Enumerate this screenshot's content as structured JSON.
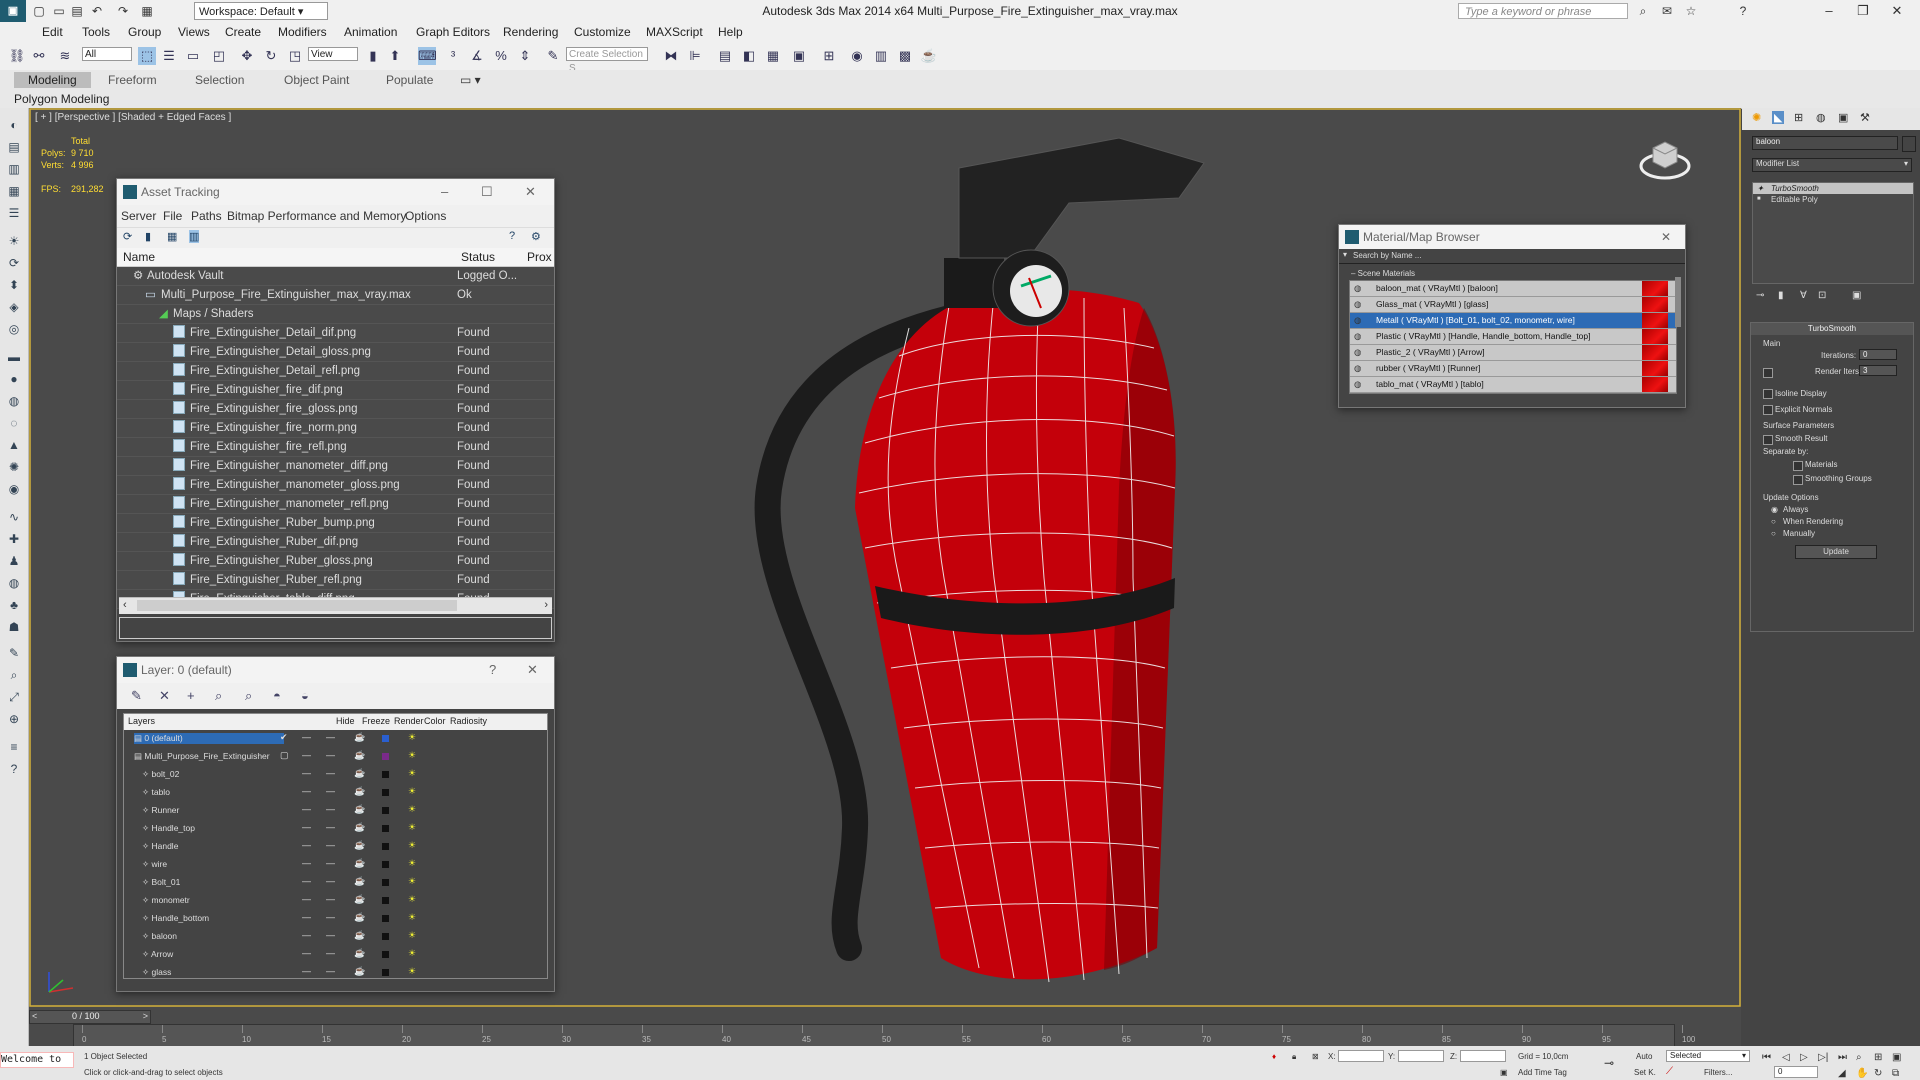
{
  "window": {
    "title": "Autodesk 3ds Max  2014 x64     Multi_Purpose_Fire_Extinguisher_max_vray.max",
    "workspace": "Workspace: Default",
    "search_placeholder": "Type a keyword or phrase"
  },
  "menu": [
    "Edit",
    "Tools",
    "Group",
    "Views",
    "Create",
    "Modifiers",
    "Animation",
    "Graph Editors",
    "Rendering",
    "Customize",
    "MAXScript",
    "Help"
  ],
  "toolbar": {
    "selection_filter": "All",
    "ref_coord": "View",
    "named_selection": "Create Selection S"
  },
  "ribbon": {
    "tabs": [
      "Modeling",
      "Freeform",
      "Selection",
      "Object Paint",
      "Populate"
    ],
    "active_tab": "Modeling",
    "panel_label": "Polygon Modeling"
  },
  "viewport": {
    "label": "[ + ] [Perspective ] [Shaded + Edged Faces ]",
    "stats_header": "Total",
    "polys_label": "Polys:",
    "polys": "9 710",
    "verts_label": "Verts:",
    "verts": "4 996",
    "fps_label": "FPS:",
    "fps": "291,282"
  },
  "asset_tracking": {
    "title": "Asset Tracking",
    "menu": [
      "Server",
      "File",
      "Paths",
      "Bitmap Performance and Memory",
      "Options"
    ],
    "columns": [
      "Name",
      "Status",
      "Prox"
    ],
    "vault": {
      "name": "Autodesk Vault",
      "status": "Logged O..."
    },
    "scene": {
      "name": "Multi_Purpose_Fire_Extinguisher_max_vray.max",
      "status": "Ok"
    },
    "group": {
      "name": "Maps / Shaders",
      "status": ""
    },
    "files": [
      {
        "name": "Fire_Extinguisher_Detail_dif.png",
        "status": "Found"
      },
      {
        "name": "Fire_Extinguisher_Detail_gloss.png",
        "status": "Found"
      },
      {
        "name": "Fire_Extinguisher_Detail_refl.png",
        "status": "Found"
      },
      {
        "name": "Fire_Extinguisher_fire_dif.png",
        "status": "Found"
      },
      {
        "name": "Fire_Extinguisher_fire_gloss.png",
        "status": "Found"
      },
      {
        "name": "Fire_Extinguisher_fire_norm.png",
        "status": "Found"
      },
      {
        "name": "Fire_Extinguisher_fire_refl.png",
        "status": "Found"
      },
      {
        "name": "Fire_Extinguisher_manometer_diff.png",
        "status": "Found"
      },
      {
        "name": "Fire_Extinguisher_manometer_gloss.png",
        "status": "Found"
      },
      {
        "name": "Fire_Extinguisher_manometer_refl.png",
        "status": "Found"
      },
      {
        "name": "Fire_Extinguisher_Ruber_bump.png",
        "status": "Found"
      },
      {
        "name": "Fire_Extinguisher_Ruber_dif.png",
        "status": "Found"
      },
      {
        "name": "Fire_Extinguisher_Ruber_gloss.png",
        "status": "Found"
      },
      {
        "name": "Fire_Extinguisher_Ruber_refl.png",
        "status": "Found"
      },
      {
        "name": "Fire_Extinguisher_tablo_diff.png",
        "status": "Found"
      }
    ]
  },
  "layer_manager": {
    "title": "Layer: 0 (default)",
    "help": "?",
    "columns": [
      "Layers",
      "Hide",
      "Freeze",
      "Render",
      "Color",
      "Radiosity"
    ],
    "rows": [
      {
        "name": "0 (default)",
        "color": "#2a5fd0",
        "level": 0,
        "selected": true
      },
      {
        "name": "Multi_Purpose_Fire_Extinguisher",
        "color": "#7a2a8a",
        "level": 0
      },
      {
        "name": "bolt_02",
        "color": "#111111",
        "level": 1
      },
      {
        "name": "tablo",
        "color": "#111111",
        "level": 1
      },
      {
        "name": "Runner",
        "color": "#111111",
        "level": 1
      },
      {
        "name": "Handle_top",
        "color": "#111111",
        "level": 1
      },
      {
        "name": "Handle",
        "color": "#111111",
        "level": 1
      },
      {
        "name": "wire",
        "color": "#111111",
        "level": 1
      },
      {
        "name": "Bolt_01",
        "color": "#111111",
        "level": 1
      },
      {
        "name": "monometr",
        "color": "#111111",
        "level": 1
      },
      {
        "name": "Handle_bottom",
        "color": "#111111",
        "level": 1
      },
      {
        "name": "baloon",
        "color": "#111111",
        "level": 1
      },
      {
        "name": "Arrow",
        "color": "#111111",
        "level": 1
      },
      {
        "name": "glass",
        "color": "#111111",
        "level": 1
      }
    ]
  },
  "material_browser": {
    "title": "Material/Map Browser",
    "search_placeholder": "Search by Name ...",
    "section": "Scene Materials",
    "materials": [
      {
        "name": "baloon_mat  ( VRayMtl ) [baloon]",
        "selected": false
      },
      {
        "name": "Glass_mat  ( VRayMtl ) [glass]",
        "selected": false
      },
      {
        "name": "Metall  ( VRayMtl ) [Bolt_01, bolt_02, monometr, wire]",
        "selected": true
      },
      {
        "name": "Plastic  ( VRayMtl ) [Handle, Handle_bottom, Handle_top]",
        "selected": false
      },
      {
        "name": "Plastic_2  ( VRayMtl ) [Arrow]",
        "selected": false
      },
      {
        "name": "rubber  ( VRayMtl ) [Runner]",
        "selected": false
      },
      {
        "name": "tablo_mat  ( VRayMtl ) [tablo]",
        "selected": false
      }
    ]
  },
  "command_panel": {
    "object_name": "baloon",
    "modifier_list": "Modifier List",
    "stack": [
      "TurboSmooth",
      "Editable Poly"
    ],
    "rollout": "TurboSmooth",
    "main": "Main",
    "iterations_label": "Iterations:",
    "iterations": "0",
    "render_iters_label": "Render Iters:",
    "render_iters": "3",
    "isoline": "Isoline Display",
    "explicit_normals": "Explicit Normals",
    "surface_params": "Surface Parameters",
    "smooth_result": "Smooth Result",
    "separate_by": "Separate by:",
    "materials": "Materials",
    "smoothing_groups": "Smoothing Groups",
    "update_options": "Update Options",
    "always": "Always",
    "when_rendering": "When Rendering",
    "manually": "Manually",
    "update_button": "Update"
  },
  "timeline": {
    "frame": "0 / 100",
    "ticks": [
      "0",
      "5",
      "10",
      "15",
      "20",
      "25",
      "30",
      "35",
      "40",
      "45",
      "50",
      "55",
      "60",
      "65",
      "70",
      "75",
      "80",
      "85",
      "90",
      "95",
      "100"
    ]
  },
  "status": {
    "maxscript": "Welcome to",
    "selection": "1 Object Selected",
    "prompt": "Click or click-and-drag to select objects",
    "x_label": "X:",
    "y_label": "Y:",
    "z_label": "Z:",
    "grid": "Grid = 10,0cm",
    "add_time_tag": "Add Time Tag",
    "auto": "Auto",
    "selected": "Selected",
    "set_k": "Set K.",
    "filters": "Filters...",
    "frame_field": "0"
  },
  "colors": {
    "accent": "#2d6bb5",
    "viewport_bg": "#4a4a4a",
    "extinguisher": "#c4000a"
  }
}
